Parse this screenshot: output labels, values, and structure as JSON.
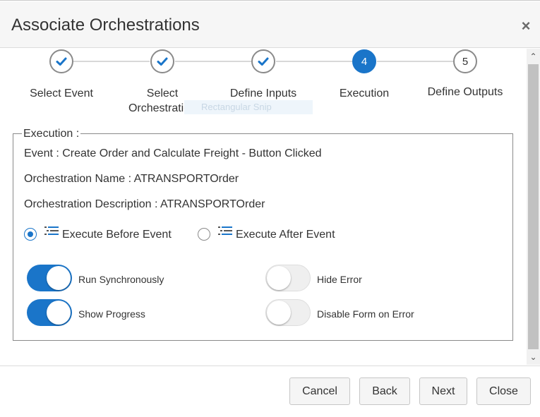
{
  "dialog": {
    "title": "Associate Orchestrations",
    "close_symbol": "×"
  },
  "stepper": {
    "steps": [
      {
        "label": "Select Event",
        "status": "done"
      },
      {
        "label": "Select Orchestration",
        "status": "done"
      },
      {
        "label": "Define Inputs",
        "status": "done"
      },
      {
        "label": "Execution",
        "status": "active",
        "number": "4"
      },
      {
        "label": "Define Outputs",
        "status": "pending",
        "number": "5"
      }
    ],
    "overlay_text": "Rectangular Snip"
  },
  "execution": {
    "legend": "Execution :",
    "event_line": "Event : Create Order and Calculate Freight - Button Clicked",
    "orchestration_name_line": "Orchestration Name : ATRANSPORTOrder",
    "orchestration_description_line": "Orchestration Description : ATRANSPORTOrder",
    "radio_options": [
      {
        "label": "Execute Before Event",
        "checked": true,
        "icon": "list-indent-icon"
      },
      {
        "label": "Execute After Event",
        "checked": false,
        "icon": "list-indent-icon"
      }
    ],
    "toggles": [
      {
        "label": "Run Synchronously",
        "on": true
      },
      {
        "label": "Show Progress",
        "on": true
      },
      {
        "label": "Hide Error",
        "on": false
      },
      {
        "label": "Disable Form on Error",
        "on": false
      }
    ]
  },
  "footer": {
    "cancel_label": "Cancel",
    "back_label": "Back",
    "next_label": "Next",
    "close_label": "Close"
  },
  "colors": {
    "accent": "#1a75c9",
    "header_bg": "#f6f6f6",
    "button_bg": "#f5f5f5"
  }
}
